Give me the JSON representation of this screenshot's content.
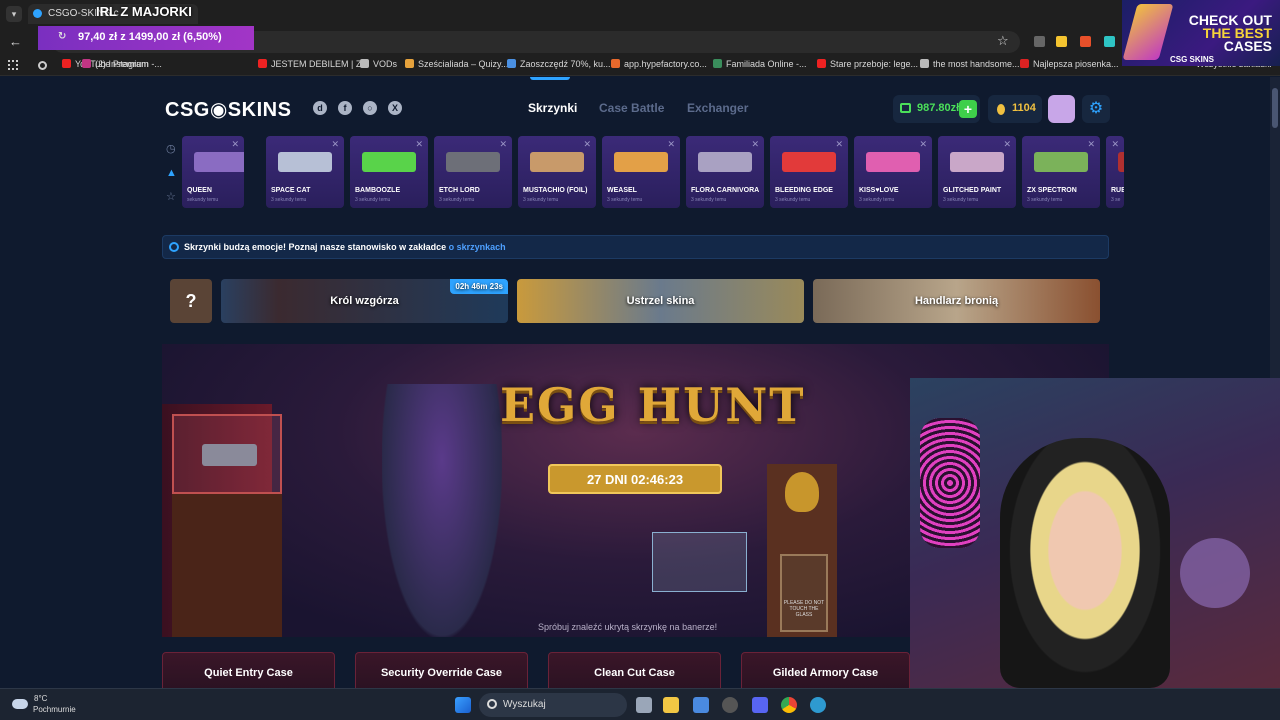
{
  "stream": {
    "title": "IRL Z MAJORKI",
    "donation": "97,40 zł z 1499,00 zł (6,50%)",
    "donation_progress_percent": 6.5,
    "promo_lines": [
      "CHECK OUT",
      "THE BEST",
      "CASES"
    ],
    "promo_brand": "CSG SKINS"
  },
  "browser": {
    "tab_title": "CSGO-SKINS.c",
    "bookmarks": [
      {
        "label": "YouTube Premium -...",
        "color": "#e22"
      },
      {
        "label": "(2) Instagram",
        "color": "#c13584"
      },
      {
        "label": "JESTEM DEBILEM | Z...",
        "color": "#e22"
      },
      {
        "label": "VODs",
        "color": "#bbb"
      },
      {
        "label": "Sześcialiada – Quizy...",
        "color": "#e6a23c"
      },
      {
        "label": "Zaoszczędź 70%, ku...",
        "color": "#4a90e2"
      },
      {
        "label": "app.hypefactory.co...",
        "color": "#e8692c"
      },
      {
        "label": "Familiada Online -...",
        "color": "#3a8d5c"
      },
      {
        "label": "Stare przeboje: lege...",
        "color": "#e22"
      },
      {
        "label": "the most handsome...",
        "color": "#bbb"
      },
      {
        "label": "Najlepsza piosenka...",
        "color": "#d22"
      }
    ],
    "all_bookmarks": "Wszystkie zakładki"
  },
  "site": {
    "logo": "CSG◉SKINS",
    "nav": [
      "Skrzynki",
      "Case Battle",
      "Exchanger"
    ],
    "active_nav": "Skrzynki",
    "balance": "987.80zł",
    "coins": "1104",
    "accent": "#2ea3ff",
    "live_drops": [
      {
        "name": "QUEEN",
        "sub": "sekundy temu",
        "gun": "#8a6cc2"
      },
      {
        "name": "SPACE CAT",
        "sub": "3 sekundy temu",
        "gun": "#b7c0d6"
      },
      {
        "name": "BAMBOOZLE",
        "sub": "3 sekundy temu",
        "gun": "#59d34a"
      },
      {
        "name": "ETCH LORD",
        "sub": "3 sekundy temu",
        "gun": "#6d6f78"
      },
      {
        "name": "MUSTACHIO (FOIL)",
        "sub": "3 sekundy temu",
        "gun": "#c89a6a"
      },
      {
        "name": "WEASEL",
        "sub": "3 sekundy temu",
        "gun": "#e3a047"
      },
      {
        "name": "FLORA CARNIVORA",
        "sub": "3 sekundy temu",
        "gun": "#a9a1c2"
      },
      {
        "name": "BLEEDING EDGE",
        "sub": "3 sekundy temu",
        "gun": "#e23a3a"
      },
      {
        "name": "KISS♥LOVE",
        "sub": "3 sekundy temu",
        "gun": "#e05fb0"
      },
      {
        "name": "GLITCHED PAINT",
        "sub": "3 sekundy temu",
        "gun": "#c9a7c8"
      },
      {
        "name": "ZX SPECTRON",
        "sub": "3 sekundy temu",
        "gun": "#7bb25a"
      },
      {
        "name": "RUB (LEN",
        "sub": "3 se",
        "gun": "#b03030"
      }
    ],
    "info_text": "Skrzynki budzą emocje! Poznaj nasze stanowisko w zakładce ",
    "info_link": "o skrzynkach",
    "tiles": [
      {
        "label": "Król wzgórza",
        "badge": "02h 46m 23s"
      },
      {
        "label": "Ustrzel skina"
      },
      {
        "label": "Handlarz bronią"
      }
    ],
    "banner": {
      "title": "EGG HUNT",
      "timer": "27 DNI  02:46:23",
      "hint": "Spróbuj znaleźć ukrytą skrzynkę na banerze!",
      "sign": "PLEASE DO NOT TOUCH THE GLASS"
    },
    "cases": [
      "Quiet Entry Case",
      "Security Override Case",
      "Clean Cut Case",
      "Gilded Armory Case"
    ]
  },
  "taskbar": {
    "temp": "8°C",
    "weather": "Pochmurnie",
    "search": "Wyszukaj"
  }
}
